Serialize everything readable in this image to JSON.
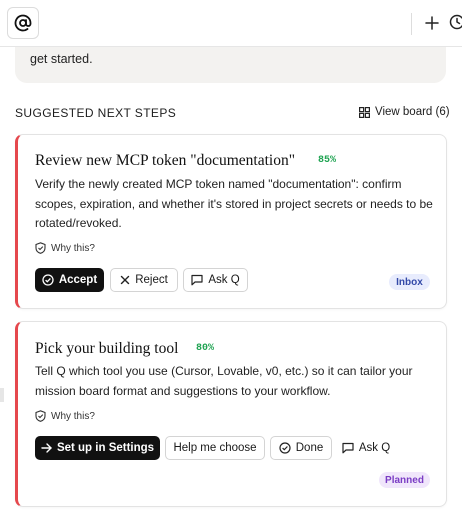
{
  "top_card": {
    "text": "get started."
  },
  "section": {
    "title": "SUGGESTED NEXT STEPS",
    "view_board_label": "View board (6)"
  },
  "cards": [
    {
      "title": "Review new MCP token \"documentation\"",
      "confidence": "85%",
      "body": "Verify the newly created MCP token named \"documentation\": confirm scopes, expiration, and whether it's stored in project secrets or needs to be rotated/revoked.",
      "why_label": "Why this?",
      "actions": {
        "accept": "Accept",
        "reject": "Reject",
        "ask": "Ask Q"
      },
      "status": "Inbox"
    },
    {
      "title": "Pick your building tool",
      "confidence": "80%",
      "body": "Tell Q which tool you use (Cursor, Lovable, v0, etc.) so it can tailor your mission board format and suggestions to your workflow.",
      "why_label": "Why this?",
      "actions": {
        "setup": "Set up in Settings",
        "help": "Help me choose",
        "done": "Done",
        "ask": "Ask Q"
      },
      "status": "Planned"
    }
  ],
  "colors": {
    "accent_bar": "#e5484d",
    "confidence": "#21a453",
    "inbox_badge": "#3349a8",
    "planned_badge": "#7a3cc4"
  }
}
